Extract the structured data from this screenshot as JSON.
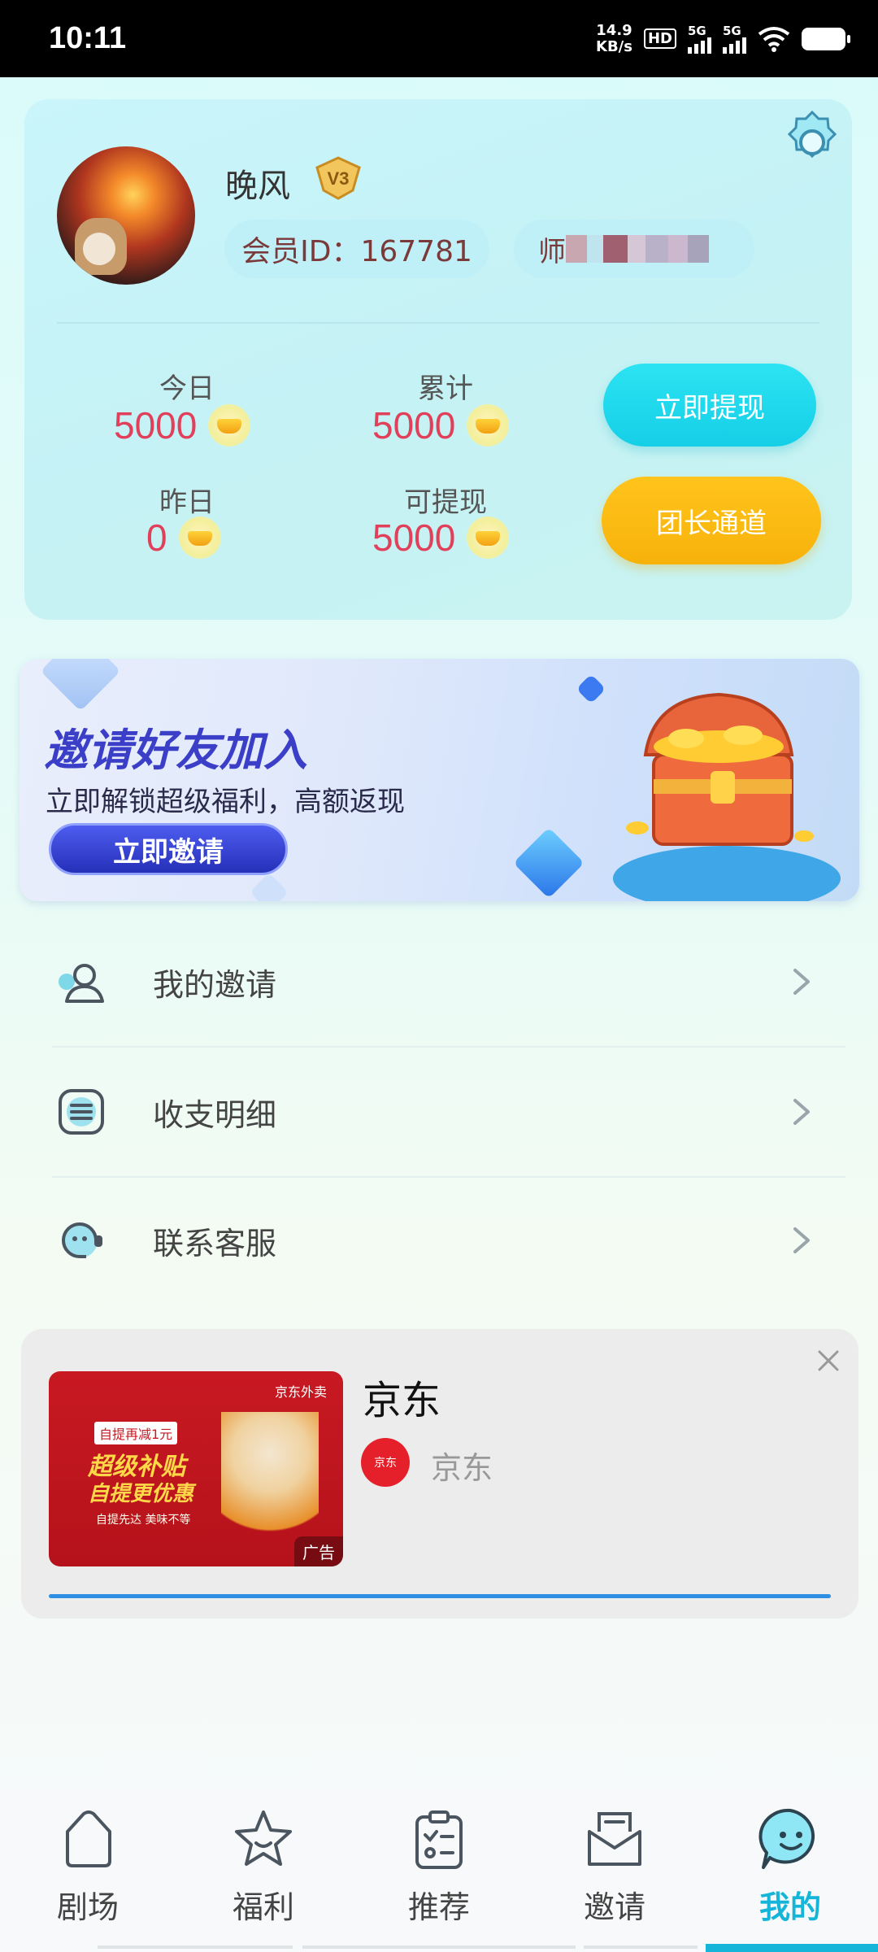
{
  "status_bar": {
    "time": "10:11",
    "net_speed_value": "14.9",
    "net_speed_unit": "KB/s",
    "hd": "HD",
    "sim1": "5G",
    "sim2": "5G"
  },
  "profile": {
    "username": "晚风",
    "vip_level": "V3",
    "member_id_text": "会员ID：167781",
    "blurred_text": "师"
  },
  "stats": {
    "today_label": "今日",
    "today_value": "5000",
    "total_label": "累计",
    "total_value": "5000",
    "yesterday_label": "昨日",
    "yesterday_value": "0",
    "withdrawable_label": "可提现",
    "withdrawable_value": "5000"
  },
  "actions": {
    "withdraw_label": "立即提现",
    "leader_label": "团长通道"
  },
  "invite_banner": {
    "title": "邀请好友加入",
    "subtitle": "立即解锁超级福利，高额返现",
    "button_label": "立即邀请"
  },
  "menu": [
    {
      "label": "我的邀请",
      "icon": "user-icon"
    },
    {
      "label": "收支明细",
      "icon": "list-icon"
    },
    {
      "label": "联系客服",
      "icon": "headset-icon"
    }
  ],
  "ad": {
    "title": "京东",
    "brand_name": "京东",
    "brand_logo_text": "京东",
    "image_brand": "京东外卖",
    "image_tag": "自提再减1元",
    "image_headline1": "超级补贴",
    "image_headline2": "自提更优惠",
    "image_small": "自提先达 美味不等",
    "ad_label": "广告"
  },
  "bottom_nav": [
    {
      "label": "剧场",
      "icon": "theater-icon",
      "active": false
    },
    {
      "label": "福利",
      "icon": "star-icon",
      "active": false
    },
    {
      "label": "推荐",
      "icon": "clipboard-icon",
      "active": false
    },
    {
      "label": "邀请",
      "icon": "mail-icon",
      "active": false
    },
    {
      "label": "我的",
      "icon": "profile-chat-icon",
      "active": true
    }
  ],
  "colors": {
    "accent_cyan": "#15cfe7",
    "accent_yellow": "#f7b20a",
    "value_red": "#e0405a",
    "nav_active": "#14b5d8"
  }
}
